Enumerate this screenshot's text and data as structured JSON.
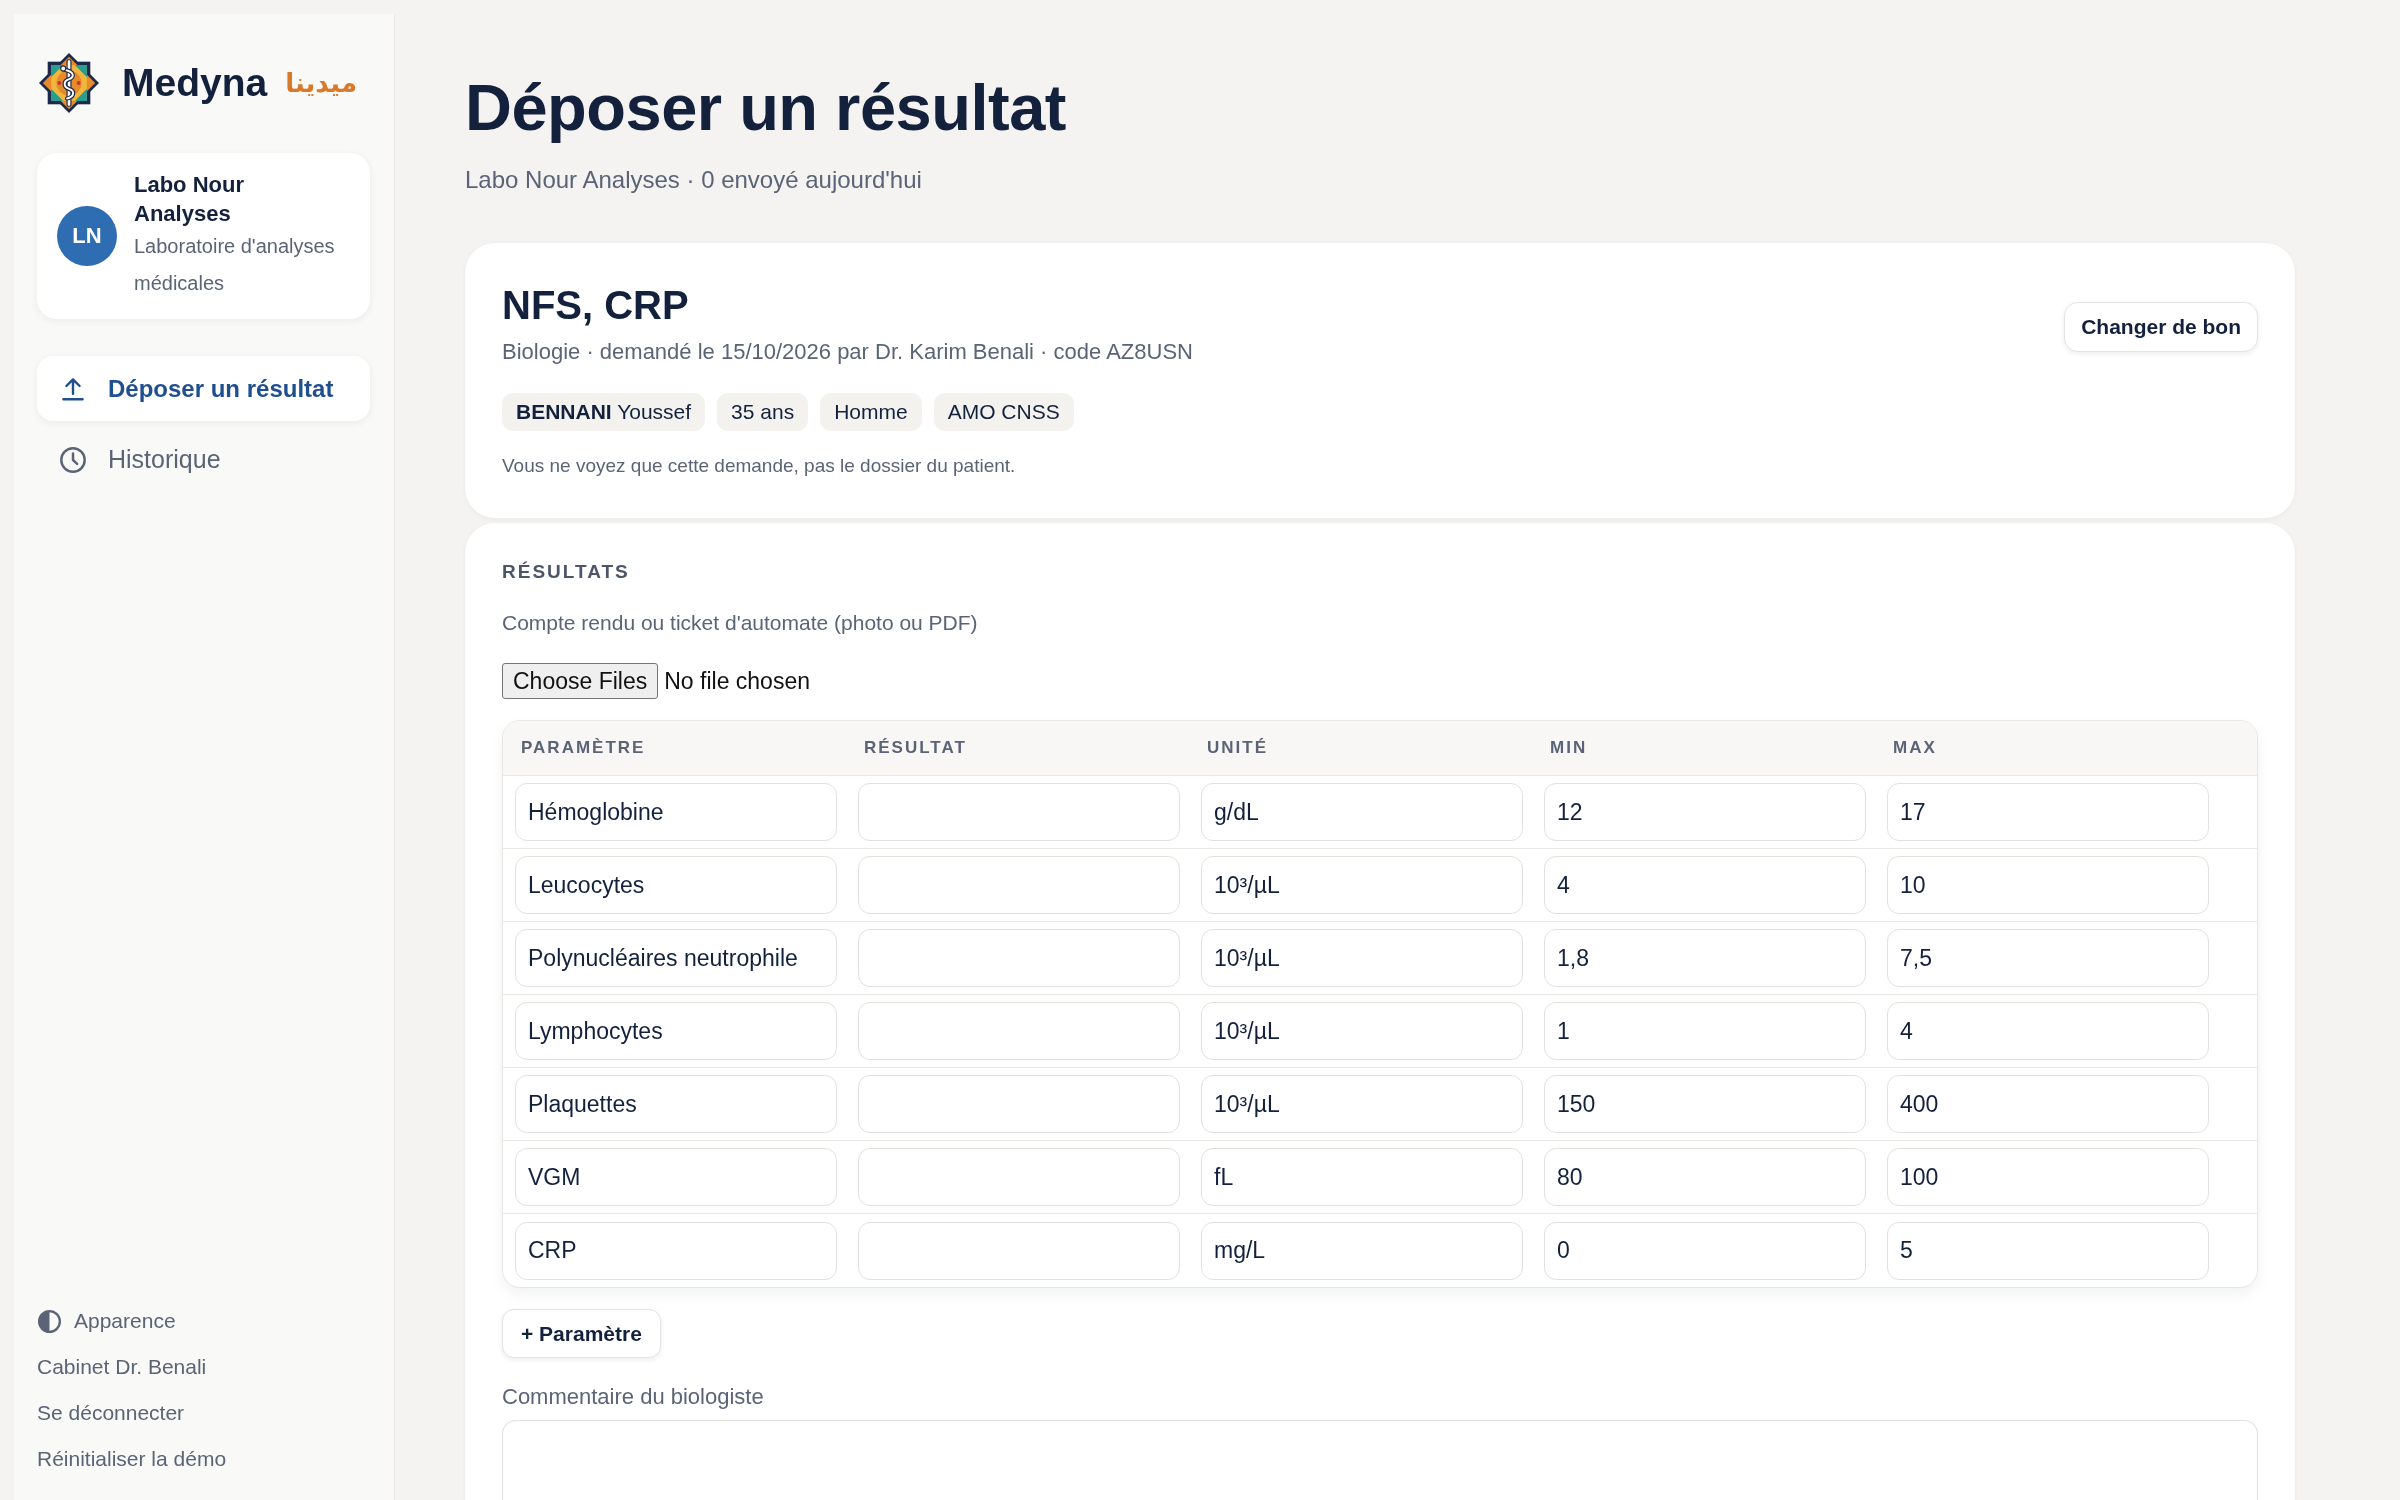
{
  "sidebar": {
    "brand": {
      "name": "Medyna",
      "name_ar": "ميدينا"
    },
    "account": {
      "initials": "LN",
      "name": "Labo Nour Analyses",
      "description": "Laboratoire d'analyses médicales"
    },
    "nav": [
      {
        "label": "Déposer un résultat",
        "selected": true
      },
      {
        "label": "Historique",
        "selected": false
      }
    ],
    "footer": [
      {
        "kind": "toggle",
        "label": "Apparence"
      },
      {
        "kind": "link",
        "label": "Cabinet Dr. Benali"
      },
      {
        "kind": "link",
        "label": "Se déconnecter"
      },
      {
        "kind": "link",
        "label": "Réinitialiser la démo"
      }
    ]
  },
  "header": {
    "title": "Déposer un résultat",
    "subtitle": "Labo Nour Analyses · 0 envoyé aujourd'hui"
  },
  "request": {
    "title": "NFS, CRP",
    "details": "Biologie · demandé le 15/10/2026 par Dr. Karim Benali · code AZ8USN",
    "button": "Changer de bon",
    "patient_tags": [
      "**BENNANI** Youssef",
      "35 ans",
      "Homme",
      "AMO CNSS"
    ],
    "notice": "Vous ne voyez que cette demande, pas le dossier du patient."
  },
  "results": {
    "heading": "RÉSULTATS",
    "attachment_label": "Compte rendu ou ticket d'automate (photo ou PDF)",
    "file_picker": {
      "button": "Choose Files",
      "status": "No file chosen"
    },
    "table": {
      "columns": [
        "PARAMÈTRE",
        "RÉSULTAT",
        "UNITÉ",
        "MIN",
        "MAX"
      ],
      "rows": [
        {
          "parameter": "Hémoglobine",
          "unit": "g/dL",
          "min": "12",
          "max": "17"
        },
        {
          "parameter": "Leucocytes",
          "unit": "10³/µL",
          "min": "4",
          "max": "10"
        },
        {
          "parameter": "Polynucléaires neutrophile",
          "unit": "10³/µL",
          "min": "1,8",
          "max": "7,5"
        },
        {
          "parameter": "Lymphocytes",
          "unit": "10³/µL",
          "min": "1",
          "max": "4"
        },
        {
          "parameter": "Plaquettes",
          "unit": "10³/µL",
          "min": "150",
          "max": "400"
        },
        {
          "parameter": "VGM",
          "unit": "fL",
          "min": "80",
          "max": "100"
        },
        {
          "parameter": "CRP",
          "unit": "mg/L",
          "min": "0",
          "max": "5"
        }
      ]
    },
    "add_button": "+ Paramètre",
    "comment": {
      "label": "Commentaire du biologiste"
    }
  }
}
